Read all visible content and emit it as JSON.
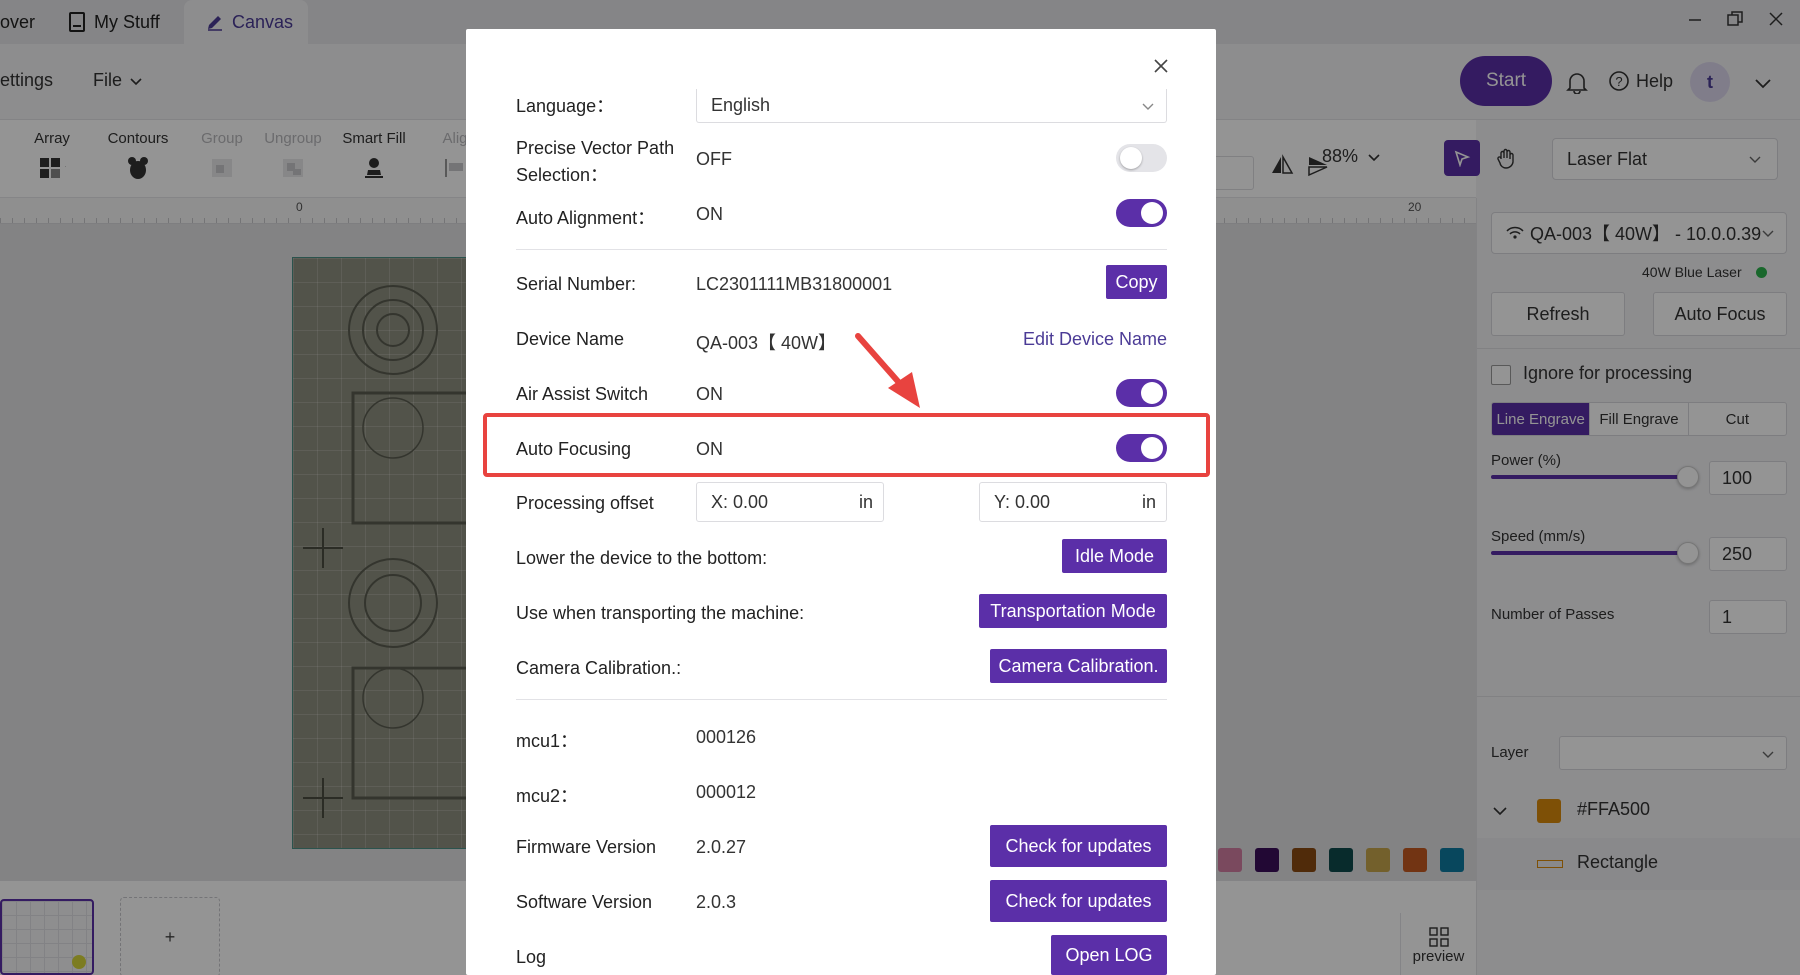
{
  "tabs": [
    {
      "label": "over"
    },
    {
      "label": "My Stuff"
    },
    {
      "label": "Canvas"
    }
  ],
  "header": {
    "menu_settings": "ettings",
    "menu_file": "File",
    "start": "Start",
    "help": "Help",
    "avatar": "t"
  },
  "toolbar": {
    "tools": [
      "Array",
      "Contours",
      "Group",
      "Ungroup",
      "Smart Fill",
      "Alig"
    ],
    "zoom": "88%",
    "laser_mode": "Laser Flat"
  },
  "ruler": {
    "left": "0",
    "right": "20"
  },
  "thumbs": {
    "add": "+",
    "preview": "preview"
  },
  "colors": {
    "accent": "#5b2fa8",
    "highlight": "#e8433f",
    "swatches": [
      "#d27fa2",
      "#3c0e5a",
      "#8b4a12",
      "#0e4a4c",
      "#c7a64c",
      "#c45b22",
      "#0f7aa1"
    ]
  },
  "right_panel": {
    "device": "QA-003【 40W】 - 10.0.0.39",
    "laser_type": "40W Blue Laser",
    "refresh": "Refresh",
    "auto_focus": "Auto Focus",
    "ignore": "Ignore for processing",
    "modes": [
      "Line Engrave",
      "Fill Engrave",
      "Cut"
    ],
    "power_label": "Power (%)",
    "power_value": "100",
    "speed_label": "Speed (mm/s)",
    "speed_value": "250",
    "passes_label": "Number of Passes",
    "passes_value": "1",
    "layer_label": "Layer",
    "layer_color_name": "#FFA500",
    "layer_item": "Rectangle"
  },
  "modal": {
    "language_label": "Language：",
    "language_value": "English",
    "precise_label_1": "Precise Vector Path",
    "precise_label_2": "Selection：",
    "precise_value": "OFF",
    "auto_align_label": "Auto Alignment：",
    "auto_align_value": "ON",
    "serial_label": "Serial Number:",
    "serial_value": "LC2301111MB31800001",
    "copy": "Copy",
    "device_name_label": "Device Name",
    "device_name_value": "QA-003【 40W】",
    "edit_device_name": "Edit Device Name",
    "air_assist_label": "Air Assist Switch",
    "air_assist_value": "ON",
    "auto_focusing_label": "Auto Focusing",
    "auto_focusing_value": "ON",
    "offset_label": "Processing offset",
    "offset_x": "X: 0.00",
    "offset_y": "Y: 0.00",
    "offset_unit": "in",
    "lower_label": "Lower the device to the bottom:",
    "idle_mode": "Idle Mode",
    "transport_label": "Use when transporting the machine:",
    "transport_mode": "Transportation Mode",
    "camera_label": "Camera Calibration.:",
    "camera_btn": "Camera Calibration.",
    "mcu1_label": "mcu1：",
    "mcu1_value": "000126",
    "mcu2_label": "mcu2：",
    "mcu2_value": "000012",
    "firmware_label": "Firmware Version",
    "firmware_value": "2.0.27",
    "software_label": "Software Version",
    "software_value": "2.0.3",
    "check_updates": "Check for updates",
    "log_label": "Log",
    "open_log": "Open LOG"
  }
}
